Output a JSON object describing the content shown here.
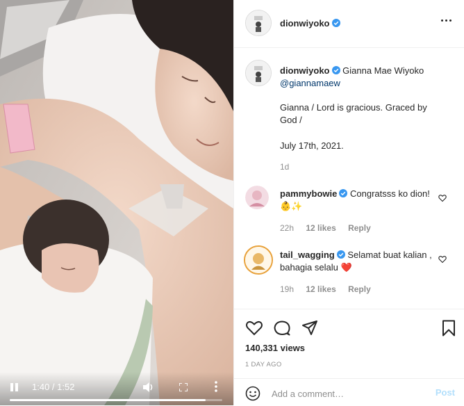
{
  "post": {
    "author": "dionwiyoko",
    "caption": {
      "author": "dionwiyoko",
      "title": "Gianna Mae Wiyoko",
      "mention": "@giannamaew",
      "line1": "Gianna / Lord is gracious. Graced by God /",
      "line2": "July 17th, 2021.",
      "age": "1d"
    },
    "comments": [
      {
        "author": "pammybowie",
        "text": "Congratsss ko dion! 👶✨",
        "age": "22h",
        "likes": "12 likes",
        "reply": "Reply"
      },
      {
        "author": "tail_wagging",
        "text": "Selamat buat kalian , bahagia selalu ❤️",
        "age": "19h",
        "likes": "12 likes",
        "reply": "Reply"
      }
    ],
    "views": "140,331 views",
    "date": "1 DAY AGO"
  },
  "video": {
    "time": "1:40 / 1:52",
    "progress": 0.92
  },
  "add_comment": {
    "placeholder": "Add a comment…",
    "post_label": "Post"
  },
  "icons": {
    "verified": "verified-badge-icon",
    "like": "heart-icon",
    "comment": "comment-bubble-icon",
    "share": "paper-plane-icon",
    "save": "bookmark-icon",
    "emoji": "smiley-icon",
    "play": "pause-icon",
    "volume": "speaker-icon",
    "fullscreen": "fullscreen-icon",
    "options": "more-dots-icon"
  },
  "colors": {
    "verified": "#3897f0",
    "link": "#00376b",
    "muted": "#8e8e8e",
    "post_disabled": "#b2dffc",
    "heart_red": "#e0201c"
  }
}
